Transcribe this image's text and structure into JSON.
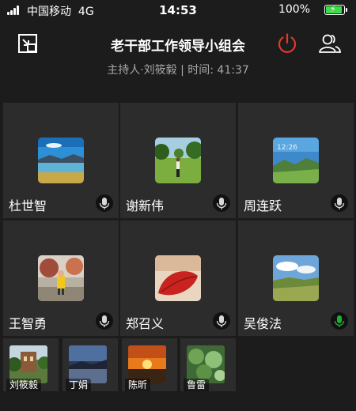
{
  "status_bar": {
    "carrier": "中国移动",
    "network": "4G",
    "time": "14:53",
    "battery": "100%",
    "battery_color": "#3ddc4b"
  },
  "header": {
    "title": "老干部工作领导小组会",
    "subtitle": "主持人·刘筱毅 | 时间: 41:37",
    "minimize_icon": "minimize-window-icon",
    "power_icon": "power-icon",
    "power_color": "#e0392b",
    "members_icon": "members-icon"
  },
  "participants": [
    {
      "name": "杜世智",
      "mic_active": false
    },
    {
      "name": "谢新伟",
      "mic_active": false
    },
    {
      "name": "周连跃",
      "mic_active": false
    },
    {
      "name": "王智勇",
      "mic_active": false
    },
    {
      "name": "郑召义",
      "mic_active": false
    },
    {
      "name": "吴俊法",
      "mic_active": true
    }
  ],
  "small_participants": [
    {
      "name": "刘筱毅"
    },
    {
      "name": "丁娟"
    },
    {
      "name": "陈昕"
    },
    {
      "name": "鲁雷"
    }
  ],
  "colors": {
    "mic_active": "#1fae2e",
    "mic_idle": "#d8d8d8",
    "tile_bg": "#2c2c2c",
    "page_bg": "#1c1c1c"
  }
}
